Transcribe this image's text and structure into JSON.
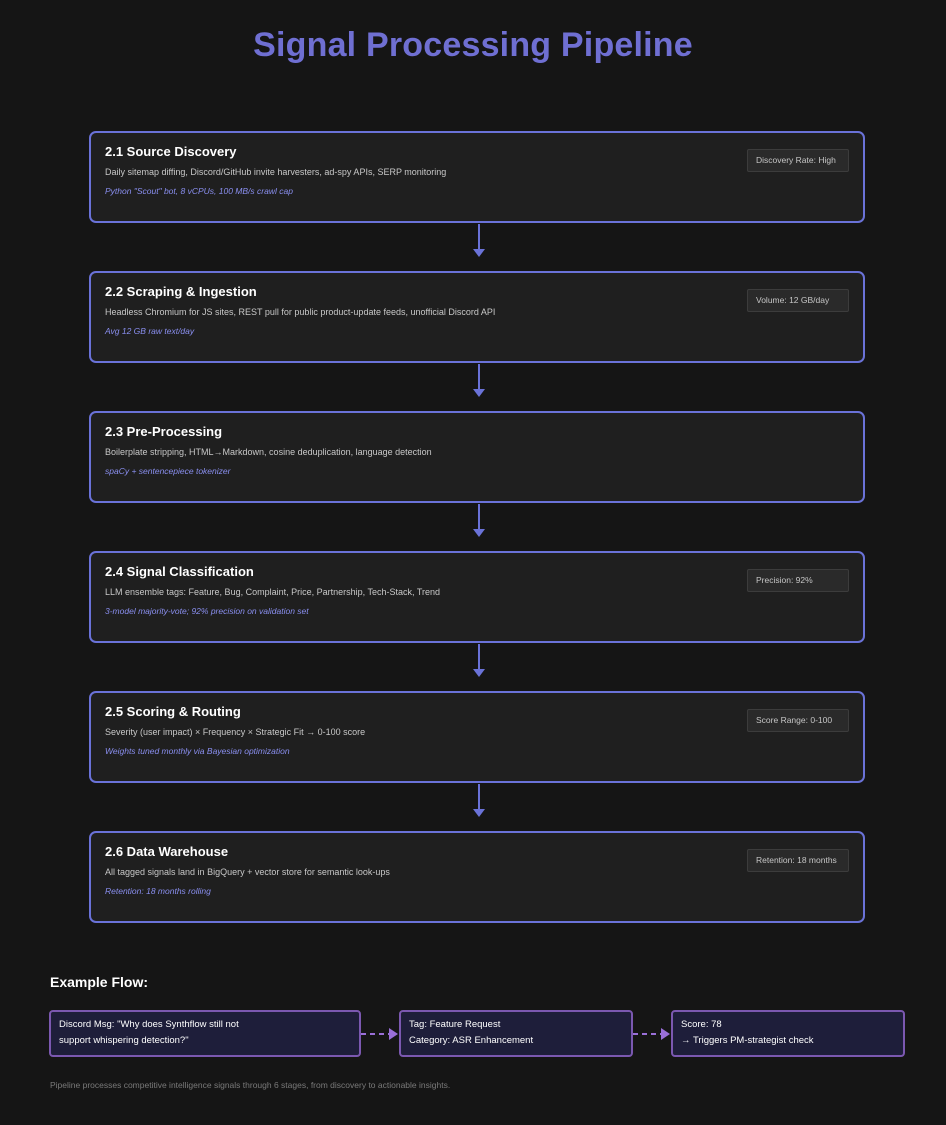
{
  "title": "Signal Processing Pipeline",
  "stages": [
    {
      "title": "2.1 Source Discovery",
      "description": "Daily sitemap diffing, Discord/GitHub invite harvesters, ad-spy APIs, SERP monitoring",
      "note": "Python \"Scout\" bot, 8 vCPUs, 100 MB/s crawl cap",
      "badge": "Discovery Rate: High"
    },
    {
      "title": "2.2 Scraping & Ingestion",
      "description": "Headless Chromium for JS sites, REST pull for public product-update feeds, unofficial Discord API",
      "note": "Avg 12 GB raw text/day",
      "badge": "Volume: 12 GB/day"
    },
    {
      "title": "2.3 Pre-Processing",
      "description": "Boilerplate stripping, HTML→Markdown, cosine deduplication, language detection",
      "note": "spaCy + sentencepiece tokenizer",
      "badge": ""
    },
    {
      "title": "2.4 Signal Classification",
      "description": "LLM ensemble tags: Feature, Bug, Complaint, Price, Partnership, Tech-Stack, Trend",
      "note": "3-model majority-vote; 92% precision on validation set",
      "badge": "Precision: 92%"
    },
    {
      "title": "2.5 Scoring & Routing",
      "description": "Severity (user impact) × Frequency × Strategic Fit → 0-100 score",
      "note": "Weights tuned monthly via Bayesian optimization",
      "badge": "Score Range: 0-100"
    },
    {
      "title": "2.6 Data Warehouse",
      "description": "All tagged signals land in BigQuery + vector store for semantic look-ups",
      "note": "Retention: 18 months rolling",
      "badge": "Retention: 18 months"
    }
  ],
  "example": {
    "heading": "Example Flow:",
    "steps": [
      {
        "line1": "Discord Msg: \"Why does Synthflow still not",
        "line2": "support whispering detection?\""
      },
      {
        "line1": "Tag: Feature Request",
        "line2": "Category: ASR Enhancement"
      },
      {
        "line1": "Score: 78",
        "line2": "→ Triggers PM-strategist check"
      }
    ]
  },
  "footer": "Pipeline processes competitive intelligence signals through 6 stages, from discovery to actionable insights.",
  "colors": {
    "background": "#151515",
    "title": "#6f6fd2",
    "stage_border": "#6a72d8",
    "note_text": "#8a8ff0",
    "flow_border": "#7b58b0",
    "flow_fill": "#1e1e3a",
    "flow_arrow": "#9a6fd8"
  }
}
